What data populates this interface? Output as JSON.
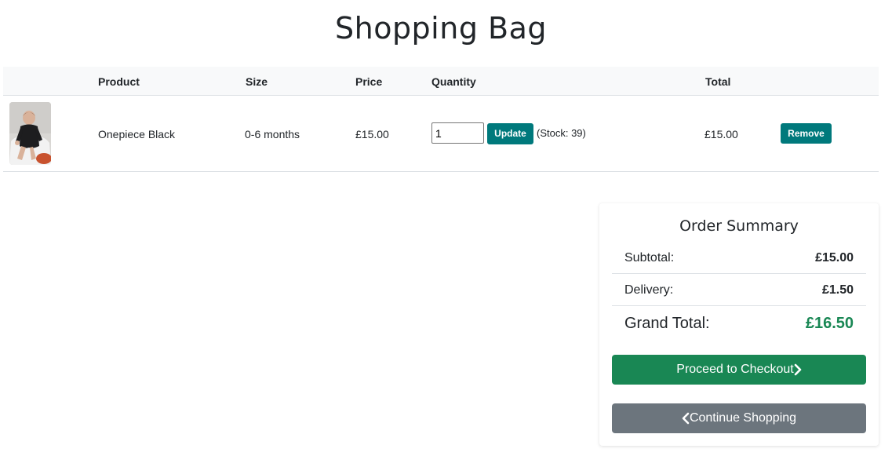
{
  "page": {
    "title": "Shopping Bag"
  },
  "table": {
    "headers": {
      "product": "Product",
      "size": "Size",
      "price": "Price",
      "quantity": "Quantity",
      "total": "Total"
    },
    "rows": [
      {
        "image": "baby-onepiece-photo",
        "product": "Onepiece Black",
        "size": "0-6 months",
        "price": "£15.00",
        "quantity": "1",
        "update_label": "Update",
        "stock": "(Stock: 39)",
        "total": "£15.00",
        "remove_label": "Remove"
      }
    ]
  },
  "summary": {
    "title": "Order Summary",
    "subtotal_label": "Subtotal:",
    "subtotal_value": "£15.00",
    "delivery_label": "Delivery:",
    "delivery_value": "£1.50",
    "grand_label": "Grand Total:",
    "grand_value": "£16.50",
    "checkout_label": "Proceed to Checkout",
    "continue_label": "Continue Shopping"
  },
  "colors": {
    "teal": "#00797c",
    "green": "#198754",
    "grey": "#6c757d"
  },
  "icons": {
    "checkout": "chevron-right-icon",
    "continue": "chevron-left-icon"
  }
}
